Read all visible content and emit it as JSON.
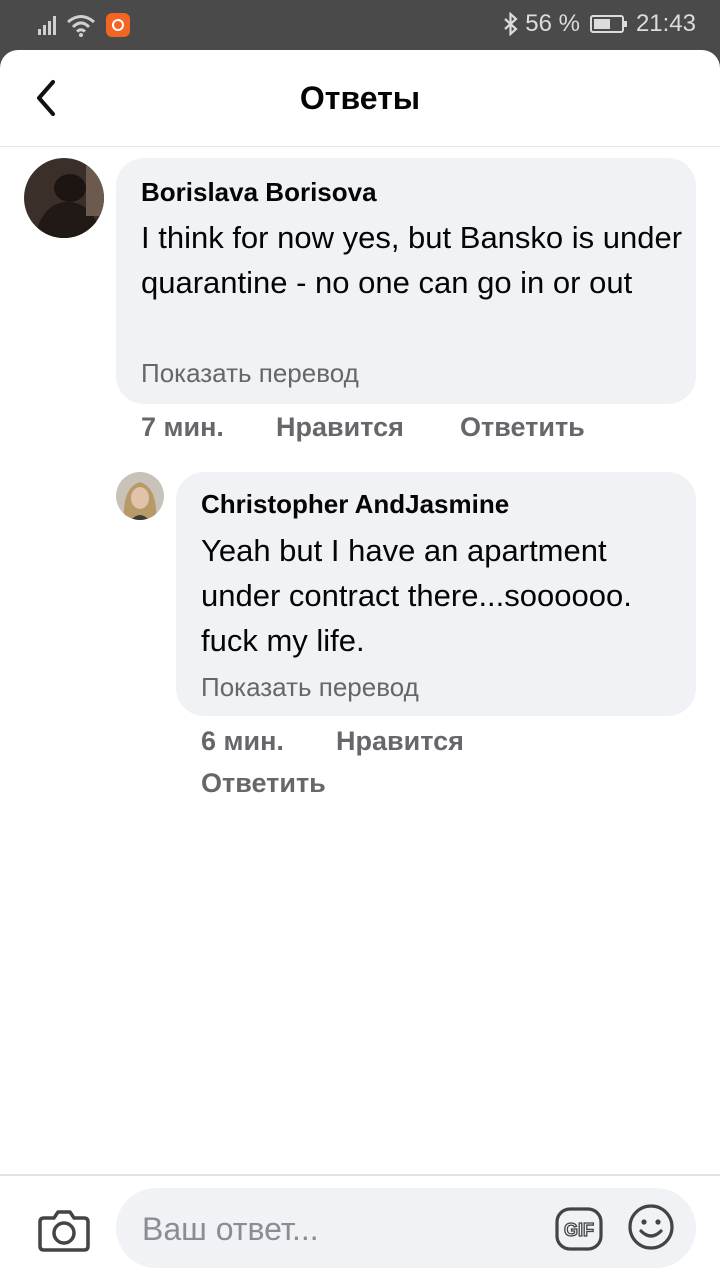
{
  "status_bar": {
    "battery_percent": "56 %",
    "time": "21:43"
  },
  "header": {
    "title": "Ответы"
  },
  "comments": [
    {
      "author": "Borislava Borisova",
      "text": "I think for now yes, but Bansko is under quarantine - no one can go in or out",
      "translate_link": "Показать перевод",
      "time": "7 мин.",
      "like_label": "Нравится",
      "reply_label": "Ответить"
    },
    {
      "author": "Christopher AndJasmine",
      "text": "Yeah but I have an apartment under contract there...soooooo. fuck my life.",
      "translate_link": "Показать перевод",
      "time": "6 мин.",
      "like_label": "Нравится",
      "reply_label": "Ответить"
    }
  ],
  "composer": {
    "placeholder": "Ваш ответ..."
  },
  "icons": {
    "back": "chevron-left-icon",
    "camera": "camera-icon",
    "gif": "gif-icon",
    "emoji": "smiley-icon",
    "bluetooth": "bluetooth-icon",
    "wifi": "wifi-icon",
    "signal": "signal-icon",
    "battery": "battery-icon"
  },
  "colors": {
    "status_bar": "#4a4a4a",
    "bubble": "#f0f2f5",
    "secondary_text": "#65676b",
    "mi_badge": "#f26522"
  }
}
